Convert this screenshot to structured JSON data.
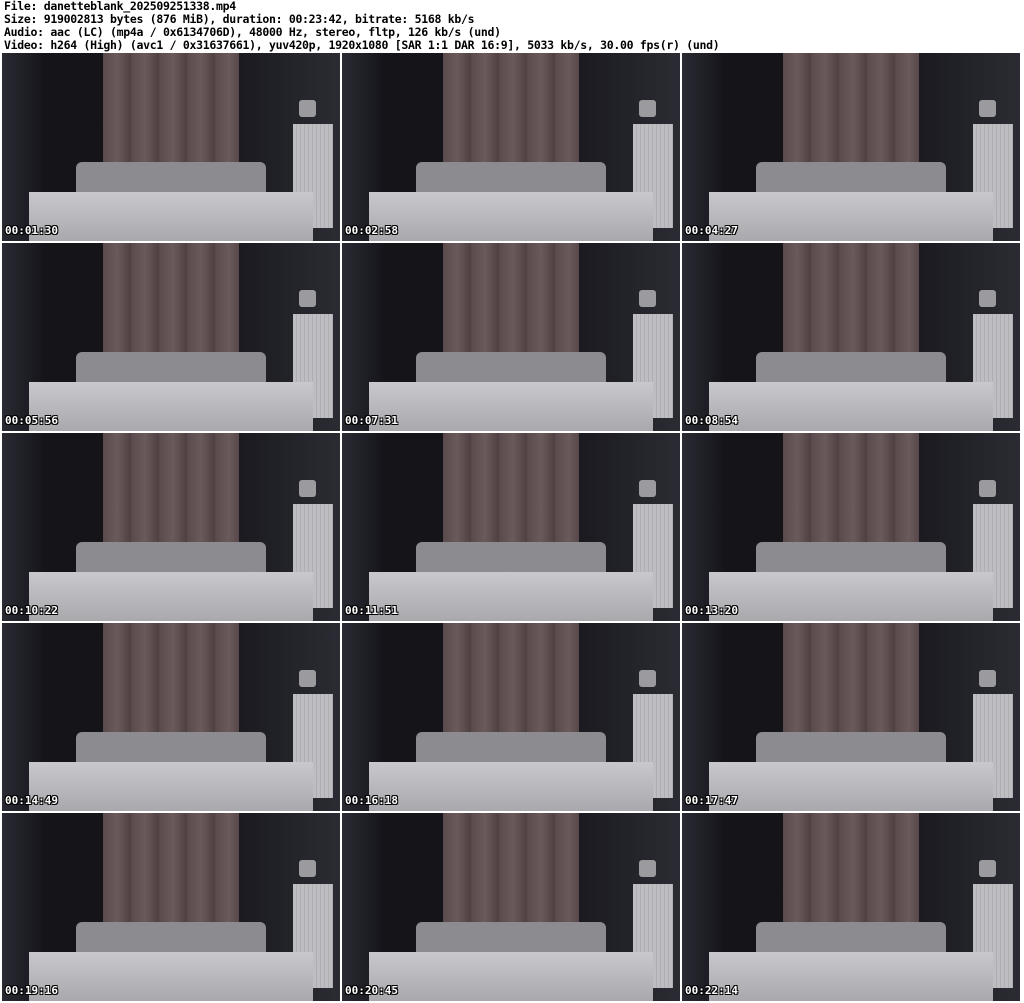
{
  "header": {
    "file": "File: danetteblank_202509251338.mp4",
    "size": "Size: 919002813 bytes (876 MiB), duration: 00:23:42, bitrate: 5168 kb/s",
    "audio": "Audio: aac (LC) (mp4a / 0x6134706D), 48000 Hz, stereo, fltp, 126 kb/s (und)",
    "video": "Video: h264 (High) (avc1 / 0x31637661), yuv420p, 1920x1080 [SAR 1:1 DAR 16:9], 5033 kb/s, 30.00 fps(r) (und)"
  },
  "thumbnails": [
    {
      "timestamp": "00:01:30"
    },
    {
      "timestamp": "00:02:58"
    },
    {
      "timestamp": "00:04:27"
    },
    {
      "timestamp": "00:05:56"
    },
    {
      "timestamp": "00:07:31"
    },
    {
      "timestamp": "00:08:54"
    },
    {
      "timestamp": "00:10:22"
    },
    {
      "timestamp": "00:11:51"
    },
    {
      "timestamp": "00:13:20"
    },
    {
      "timestamp": "00:14:49"
    },
    {
      "timestamp": "00:16:18"
    },
    {
      "timestamp": "00:17:47"
    },
    {
      "timestamp": "00:19:16"
    },
    {
      "timestamp": "00:20:45"
    },
    {
      "timestamp": "00:22:14"
    }
  ]
}
